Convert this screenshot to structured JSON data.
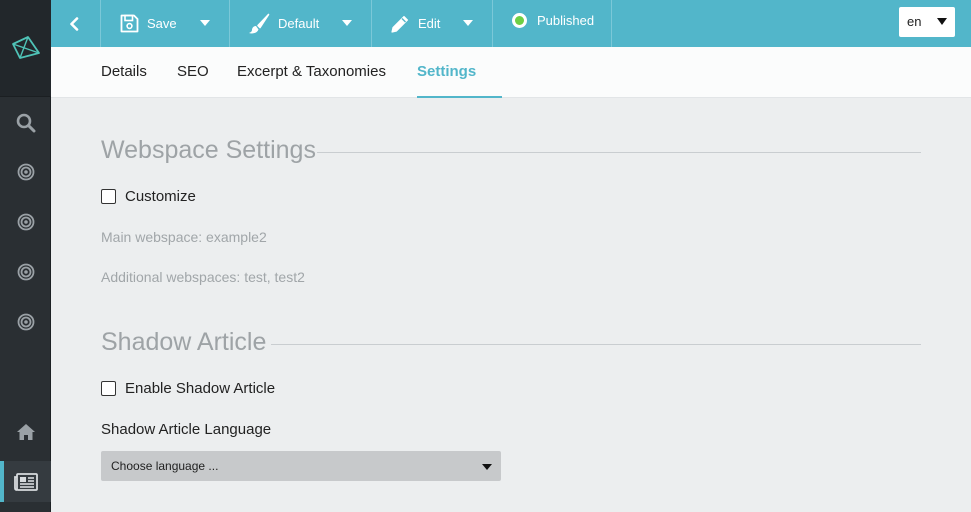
{
  "toolbar": {
    "save_label": "Save",
    "template_label": "Default",
    "edit_label": "Edit",
    "status_label": "Published",
    "language": "en"
  },
  "tabs": [
    {
      "label": "Details"
    },
    {
      "label": "SEO"
    },
    {
      "label": "Excerpt & Taxonomies"
    },
    {
      "label": "Settings",
      "active": true
    }
  ],
  "webspace": {
    "title": "Webspace Settings",
    "customize_label": "Customize",
    "main_webspace": "Main webspace: example2",
    "additional_webspaces": "Additional webspaces: test, test2"
  },
  "shadow": {
    "title": "Shadow Article",
    "enable_label": "Enable Shadow Article",
    "language_label": "Shadow Article Language",
    "language_placeholder": "Choose language ..."
  },
  "colors": {
    "accent": "#52b6ca",
    "sidebar": "#2a2f33",
    "status_published": "#6fcf45"
  }
}
